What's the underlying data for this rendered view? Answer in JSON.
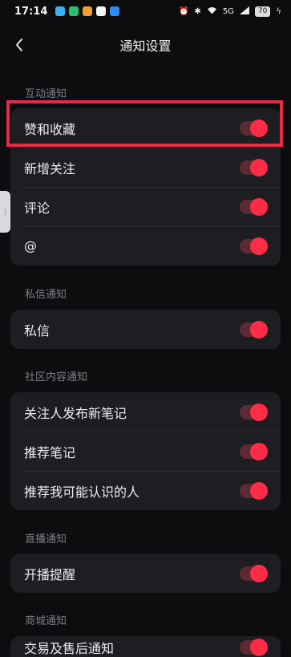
{
  "status_bar": {
    "time": "17:14",
    "network": "5G",
    "battery": "70"
  },
  "header": {
    "title": "通知设置"
  },
  "sections": [
    {
      "title": "互动通知",
      "items": [
        {
          "label": "赞和收藏",
          "enabled": true
        },
        {
          "label": "新增关注",
          "enabled": true
        },
        {
          "label": "评论",
          "enabled": true
        },
        {
          "label": "@",
          "enabled": true
        }
      ]
    },
    {
      "title": "私信通知",
      "items": [
        {
          "label": "私信",
          "enabled": true
        }
      ]
    },
    {
      "title": "社区内容通知",
      "items": [
        {
          "label": "关注人发布新笔记",
          "enabled": true
        },
        {
          "label": "推荐笔记",
          "enabled": true
        },
        {
          "label": "推荐我可能认识的人",
          "enabled": true
        }
      ]
    },
    {
      "title": "直播通知",
      "items": [
        {
          "label": "开播提醒",
          "enabled": true
        }
      ]
    },
    {
      "title": "商城通知",
      "items": [
        {
          "label": "交易及售后通知",
          "enabled": true
        }
      ]
    }
  ],
  "colors": {
    "accent": "#fe2c46",
    "toggle_track": "#5c2a32",
    "card_bg": "#1e1e22",
    "page_bg": "#0d0d10",
    "highlight": "#e52b45"
  }
}
